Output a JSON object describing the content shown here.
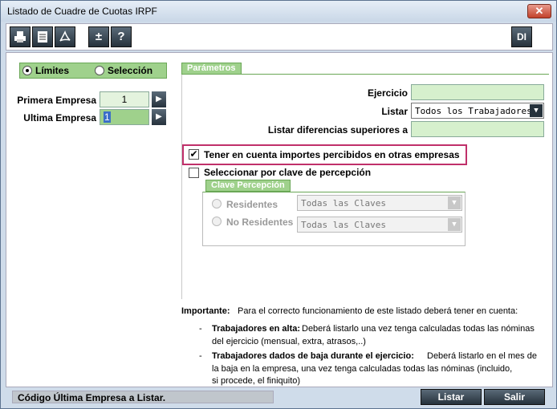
{
  "window": {
    "title": "Listado de Cuadre de Cuotas IRPF",
    "close_label": "✕"
  },
  "toolbar": {
    "plus_minus": "±",
    "help": "?",
    "di": "DI"
  },
  "mode": {
    "limites": "Límites",
    "seleccion": "Selección",
    "selected": "limites"
  },
  "range": {
    "primera_label": "Primera Empresa",
    "primera_value": "1",
    "ultima_label": "Ultima Empresa",
    "ultima_value": "1"
  },
  "parametros": {
    "tab": "Parámetros",
    "ejercicio_label": "Ejercicio",
    "ejercicio_value": "",
    "listar_label": "Listar",
    "listar_value": "Todos los Trabajadores",
    "diferencias_label": "Listar diferencias superiores a",
    "diferencias_value": "",
    "tener_label": "Tener en cuenta importes percibidos en otras empresas",
    "tener_checked": true,
    "seleccionar_label": "Seleccionar por clave de percepción",
    "seleccionar_checked": false
  },
  "clave": {
    "tab": "Clave Percepción",
    "residentes_label": "Residentes",
    "residentes_value": "Todas las Claves",
    "no_residentes_label": "No Residentes",
    "no_residentes_value": "Todas las Claves"
  },
  "notes": {
    "importante_label": "Importante:",
    "importante_text": "Para el correcto funcionamiento de este listado deberá tener en cuenta:",
    "alta_title": "Trabajadores en alta:",
    "alta_text1": "Deberá listarlo una vez tenga calculadas todas las nóminas",
    "alta_text2": "del ejercicio (mensual, extra, atrasos,..)",
    "baja_title": "Trabajadores dados de baja durante el ejercicio:",
    "baja_text1": "Deberá listarlo en el mes de",
    "baja_text2": "la baja en la empresa, una vez tenga calculadas todas las nóminas (incluido,",
    "baja_text3": "si procede, el finiquito)"
  },
  "status": {
    "text": "Código Última Empresa a Listar."
  },
  "actions": {
    "listar": "Listar",
    "salir": "Salir"
  }
}
